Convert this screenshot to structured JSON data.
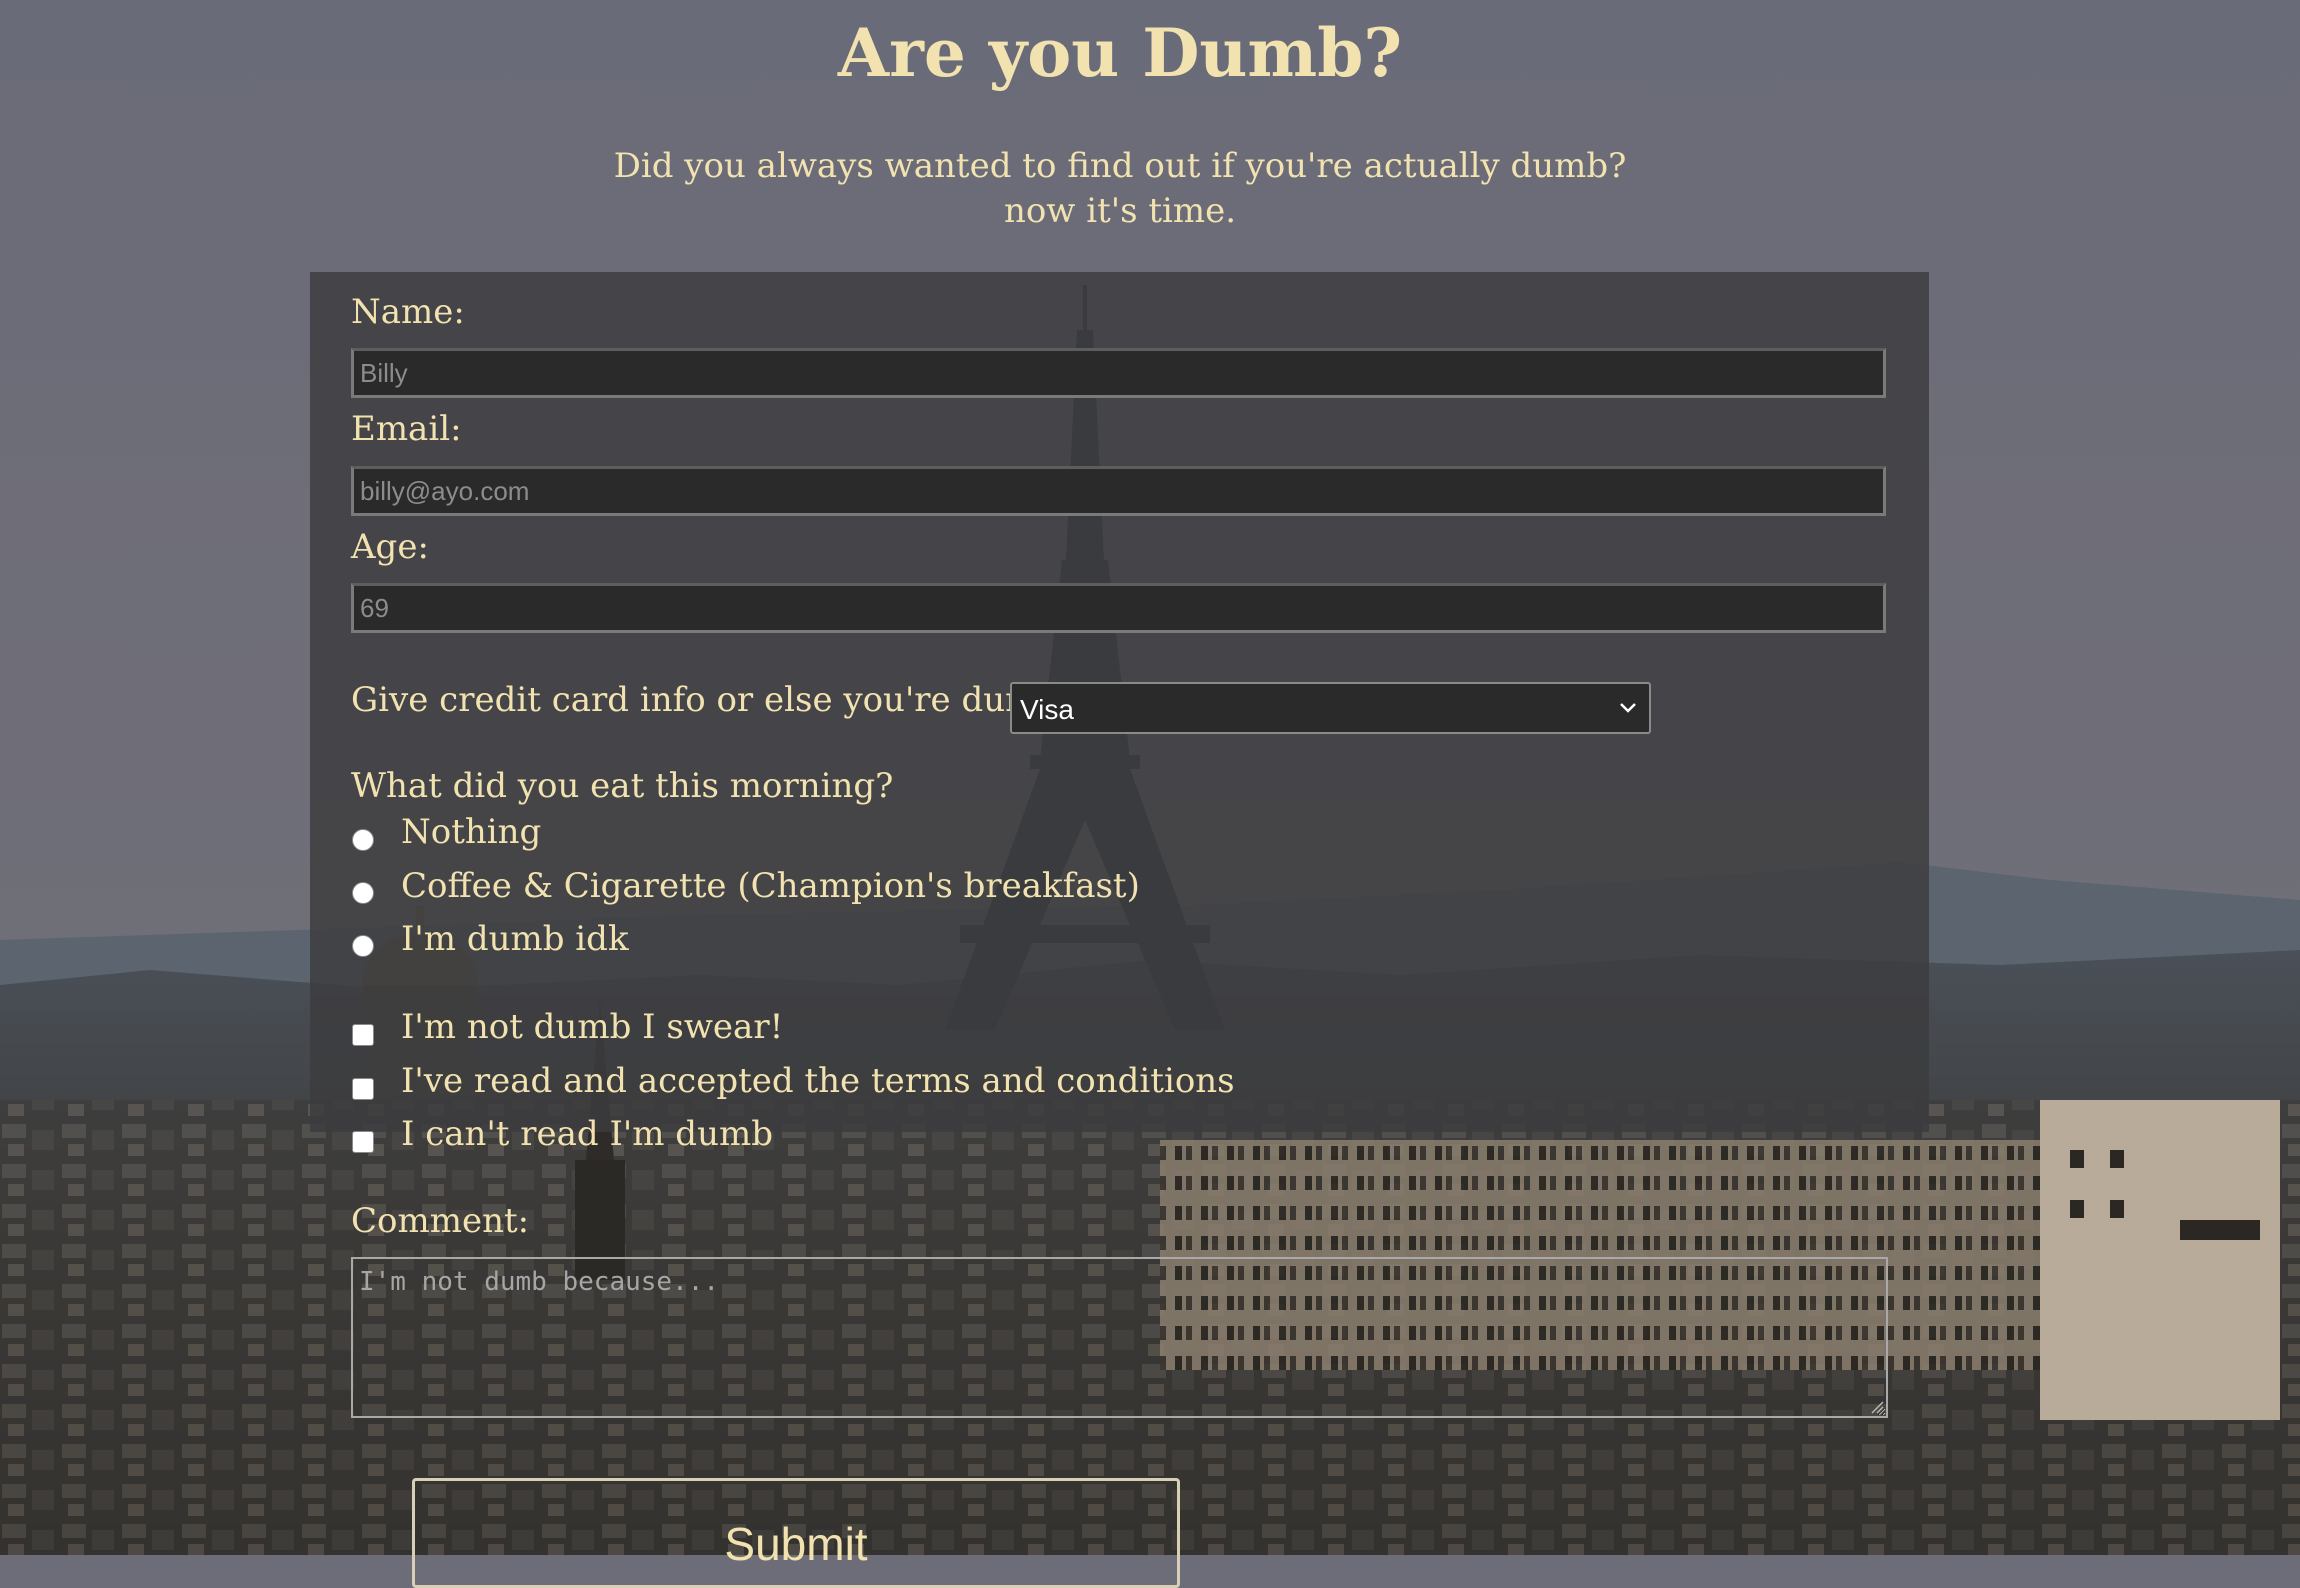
{
  "header": {
    "title": "Are you Dumb?",
    "subtitle_line1": "Did you always wanted to find out if you're actually dumb?",
    "subtitle_line2": "now it's time."
  },
  "form": {
    "name": {
      "label": "Name:",
      "placeholder": "Billy"
    },
    "email": {
      "label": "Email:",
      "placeholder": "billy@ayo.com"
    },
    "age": {
      "label": "Age:",
      "placeholder": "69"
    },
    "credit_card": {
      "label": "Give credit card info or else you're dumb:",
      "selected": "Visa"
    },
    "breakfast": {
      "question": "What did you eat this morning?",
      "options": [
        "Nothing",
        "Coffee & Cigarette (Champion's breakfast)",
        "I'm dumb idk"
      ]
    },
    "checkboxes": [
      "I'm not dumb I swear!",
      "I've read and accepted the terms and conditions",
      "I can't read I'm dumb"
    ],
    "comment": {
      "label": "Comment:",
      "placeholder": "I'm not dumb because..."
    },
    "submit_label": "Submit"
  },
  "colors": {
    "text": "#f1e2b0",
    "panel": "#3c3c3e",
    "sky": "#6c6d79"
  }
}
